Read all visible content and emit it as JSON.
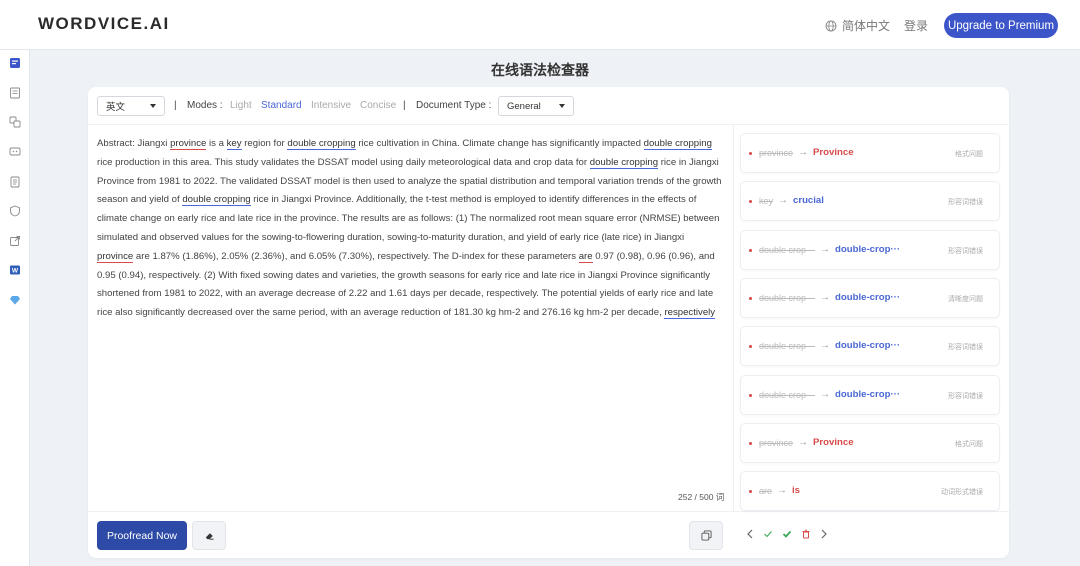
{
  "header": {
    "logo": "WORDVICE.AI",
    "language": "简体中文",
    "login": "登录",
    "upgrade": "Upgrade to Premium"
  },
  "page_title": "在线语法检查器",
  "toolbar": {
    "language_select": "英文",
    "separator": "|",
    "modes_label": "Modes :",
    "modes": [
      "Light",
      "Standard",
      "Intensive",
      "Concise"
    ],
    "active_mode": "Standard",
    "doc_type_label": "Document Type :",
    "doc_type": "General"
  },
  "editor": {
    "segments": [
      {
        "t": "Abstract: Jiangxi "
      },
      {
        "t": "province",
        "u": "red"
      },
      {
        "t": " is a "
      },
      {
        "t": "key",
        "u": "blue"
      },
      {
        "t": " region for "
      },
      {
        "t": "double cropping",
        "u": "blue"
      },
      {
        "t": " rice cultivation in China. Climate change has significantly impacted "
      },
      {
        "t": "double cropping",
        "u": "blue"
      },
      {
        "t": " rice production in this area. This study validates the DSSAT model using daily meteorological data and crop data for "
      },
      {
        "t": "double cropping",
        "u": "blue"
      },
      {
        "t": " rice in Jiangxi Province from 1981 to 2022. The validated DSSAT model is then used to analyze the spatial distribution and temporal variation trends of the growth season and yield of "
      },
      {
        "t": "double cropping",
        "u": "blue"
      },
      {
        "t": " rice in Jiangxi Province. Additionally, the t-test method is employed to identify differences in the effects of climate change on early rice and late rice in the province. The results are as follows: (1) The normalized root mean square error (NRMSE) between simulated and observed values for the sowing-to-flowering duration, sowing-to-maturity duration, and yield of early rice (late rice) in Jiangxi "
      },
      {
        "t": "province",
        "u": "red"
      },
      {
        "t": " are 1.87% (1.86%), 2.05% (2.36%), and 6.05% (7.30%), respectively. The D-index for these parameters "
      },
      {
        "t": "are",
        "u": "red"
      },
      {
        "t": " 0.97 (0.98), 0.96 (0.96), and 0.95 (0.94), respectively. (2) With fixed sowing dates and varieties, the growth seasons for early rice and late rice in Jiangxi Province significantly shortened from 1981 to 2022, with an average decrease of 2.22 and 1.61 days per decade, respectively. The potential yields of early rice and late rice also significantly decreased over the same period, with an average reduction of 181.30 kg hm-2 and 276.16 kg hm-2 per decade, "
      },
      {
        "t": "respectively",
        "u": "blue"
      }
    ],
    "word_count": "252 / 500 词"
  },
  "suggestions": [
    {
      "from": "province",
      "to": "Province",
      "tag": "格式问题",
      "color": "#d84a4a"
    },
    {
      "from": "key",
      "to": "crucial",
      "tag": "形容词错误",
      "color": "#4a67d6"
    },
    {
      "from": "double crop···",
      "to": "double-crop···",
      "tag": "形容词错误",
      "color": "#4a67d6"
    },
    {
      "from": "double crop···",
      "to": "double-crop···",
      "tag": "清晰度问题",
      "color": "#4a67d6"
    },
    {
      "from": "double crop···",
      "to": "double-crop···",
      "tag": "形容词错误",
      "color": "#4a67d6"
    },
    {
      "from": "double crop···",
      "to": "double-crop···",
      "tag": "形容词错误",
      "color": "#4a67d6"
    },
    {
      "from": "province",
      "to": "Province",
      "tag": "格式问题",
      "color": "#d84a4a"
    },
    {
      "from": "are",
      "to": "is",
      "tag": "动词形式错误",
      "color": "#d84a4a"
    }
  ],
  "footer": {
    "proofread": "Proofread Now"
  },
  "icons": {
    "rail": [
      "grammar-icon",
      "document-icon",
      "translate-icon",
      "chat-icon",
      "notes-icon",
      "shield-icon",
      "export-icon",
      "word-icon",
      "diamond-icon"
    ],
    "globe": "globe-icon"
  },
  "colors": {
    "accent": "#3c55c9",
    "proofread_button": "#2c4aa6",
    "error_red": "#d84a4a",
    "suggestion_blue": "#4a67d6"
  }
}
